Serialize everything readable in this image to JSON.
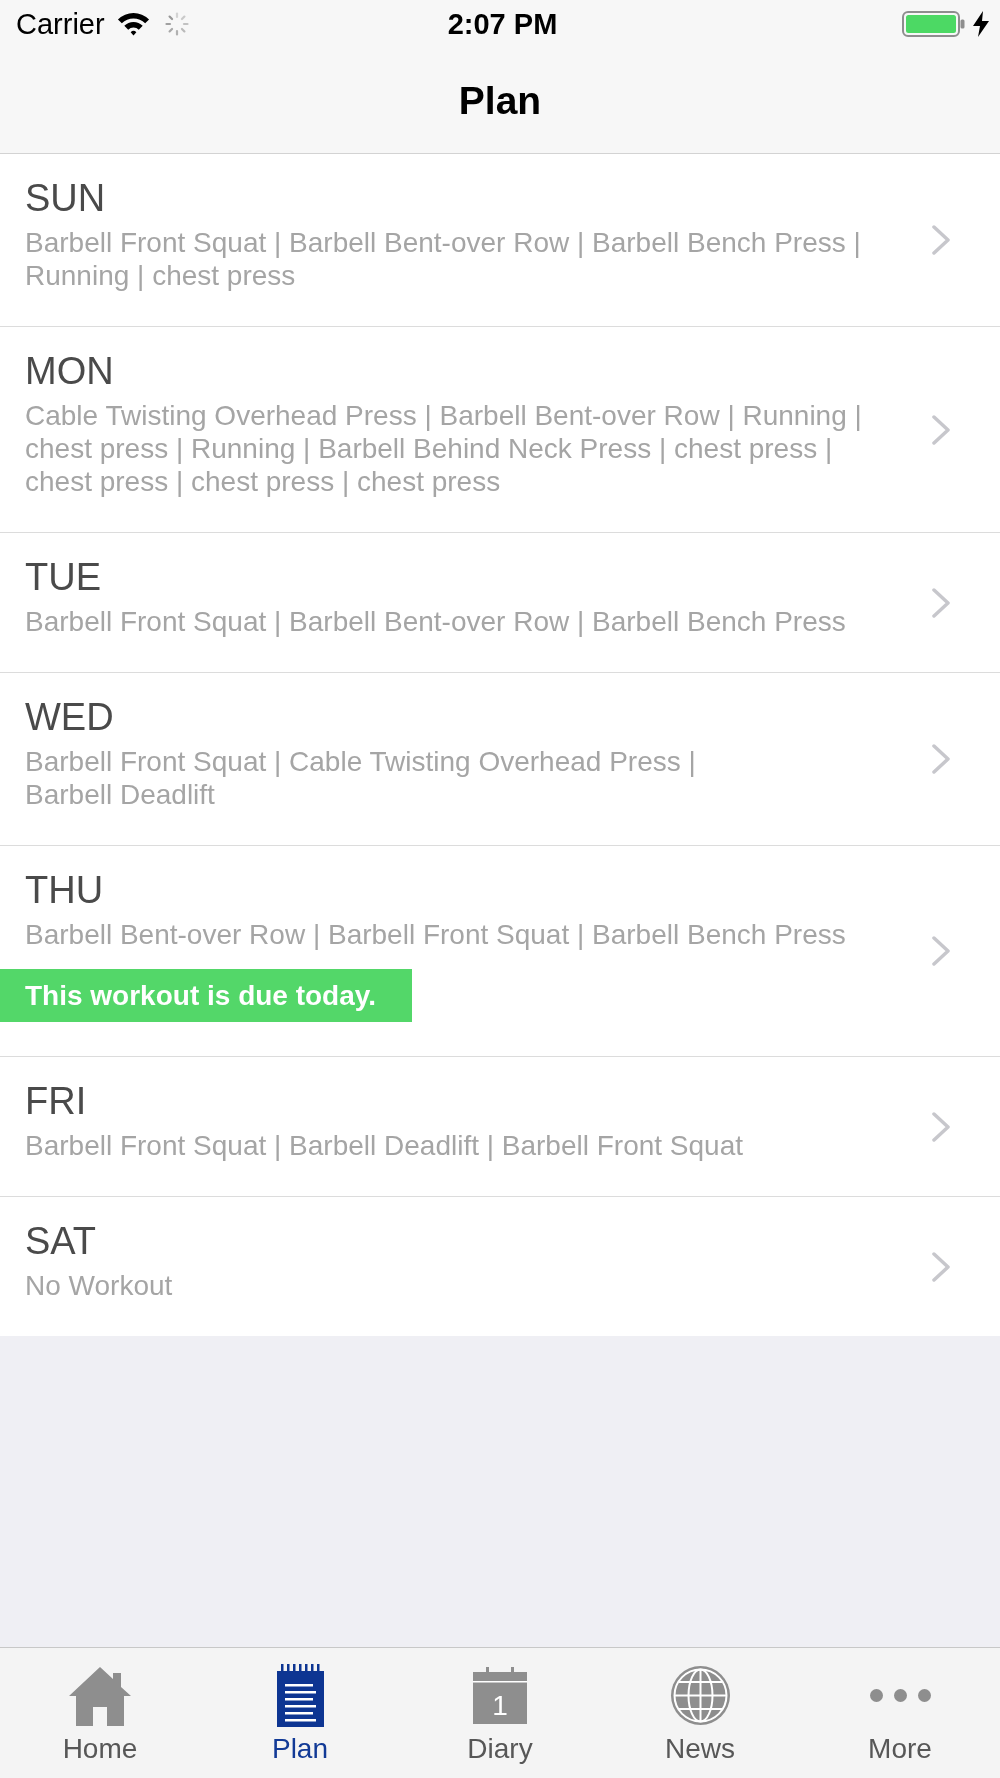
{
  "status_bar": {
    "carrier": "Carrier",
    "time": "2:07 PM",
    "network_activity": true,
    "charging": true
  },
  "nav_bar": {
    "title": "Plan"
  },
  "days": [
    {
      "day": "SUN",
      "exercises": "Barbell Front Squat | Barbell Bent-over Row | Barbell Bench Press |\nRunning | chest press"
    },
    {
      "day": "MON",
      "exercises": "Cable Twisting Overhead Press | Barbell Bent-over Row | Running |\nchest press | Running | Barbell Behind Neck Press | chest press |\nchest press | chest press | chest press"
    },
    {
      "day": "TUE",
      "exercises": "Barbell Front Squat | Barbell Bent-over Row | Barbell Bench Press"
    },
    {
      "day": "WED",
      "exercises": "Barbell Front Squat | Cable Twisting Overhead Press |\nBarbell Deadlift"
    },
    {
      "day": "THU",
      "exercises": "Barbell Bent-over Row | Barbell Front Squat | Barbell Bench Press",
      "notice": "This workout is due today."
    },
    {
      "day": "FRI",
      "exercises": "Barbell Front Squat | Barbell Deadlift | Barbell Front Squat"
    },
    {
      "day": "SAT",
      "exercises": "No Workout"
    }
  ],
  "tab_bar": {
    "tabs": [
      {
        "kind": "home",
        "label": "Home",
        "selected": false
      },
      {
        "kind": "plan",
        "label": "Plan",
        "selected": true
      },
      {
        "kind": "diary",
        "label": "Diary",
        "icon_text": "1",
        "selected": false
      },
      {
        "kind": "news",
        "label": "News",
        "selected": false
      },
      {
        "kind": "more",
        "label": "More",
        "selected": false
      }
    ]
  }
}
